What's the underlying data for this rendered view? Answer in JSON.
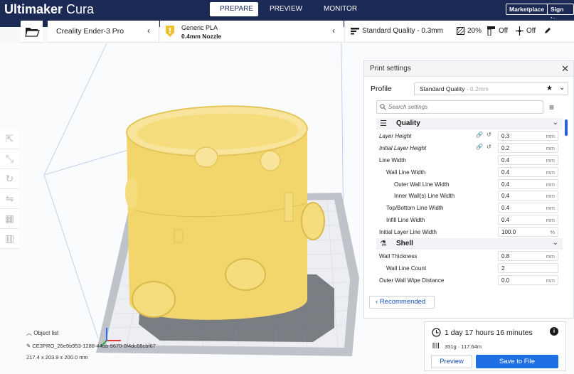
{
  "app": {
    "brand_bold": "Ultimaker",
    "brand_light": " Cura"
  },
  "stages": [
    "PREPARE",
    "PREVIEW",
    "MONITOR"
  ],
  "header_buttons": {
    "marketplace": "Marketplace",
    "signin": "Sign in"
  },
  "printer": {
    "name": "Creality Ender-3 Pro"
  },
  "material": {
    "name": "Generic PLA",
    "nozzle": "0.4mm Nozzle"
  },
  "quality_bar": {
    "profile": "Standard Quality - 0.3mm",
    "infill": "20%",
    "support": "Off",
    "adhesion": "Off"
  },
  "print_settings": {
    "title": "Print settings",
    "profile_label": "Profile",
    "profile_name": "Standard Quality",
    "profile_suffix": " - 0.2mm",
    "search_placeholder": "Search settings",
    "categories": [
      {
        "name": "Quality",
        "icon": "quality-icon"
      },
      {
        "name": "Shell",
        "icon": "shell-icon"
      }
    ],
    "quality_rows": [
      {
        "label": "Layer Height",
        "value": "0.3",
        "unit": "mm",
        "italic": true,
        "linked": true
      },
      {
        "label": "Initial Layer Height",
        "value": "0.2",
        "unit": "mm",
        "italic": true,
        "linked": true
      },
      {
        "label": "Line Width",
        "value": "0.4",
        "unit": "mm"
      },
      {
        "label": "Wall Line Width",
        "value": "0.4",
        "unit": "mm"
      },
      {
        "label": "Outer Wall Line Width",
        "value": "0.4",
        "unit": "mm"
      },
      {
        "label": "Inner Wall(s) Line Width",
        "value": "0.4",
        "unit": "mm"
      },
      {
        "label": "Top/Bottom Line Width",
        "value": "0.4",
        "unit": "mm"
      },
      {
        "label": "Infill Line Width",
        "value": "0.4",
        "unit": "mm"
      },
      {
        "label": "Initial Layer Line Width",
        "value": "100.0",
        "unit": "%"
      }
    ],
    "shell_rows": [
      {
        "label": "Wall Thickness",
        "value": "0.8",
        "unit": "mm"
      },
      {
        "label": "Wall Line Count",
        "value": "2",
        "unit": ""
      },
      {
        "label": "Outer Wall Wipe Distance",
        "value": "0.0",
        "unit": "mm"
      }
    ],
    "recommended_label": "Recommended"
  },
  "estimate": {
    "time": "1 day 17 hours 16 minutes",
    "material": "351g · 117.64m",
    "preview_label": "Preview",
    "save_label": "Save to File"
  },
  "object_list": {
    "label": "Object list",
    "object_name": "CE3PRO_26e9b953-1288-44ab-9670-0f4dc88cbf67",
    "dimensions": "217.4 x 203.9 x 200.0 mm"
  },
  "colors": {
    "header": "#1b2a55",
    "model": "#f7dc78",
    "accent": "#1f6fe5",
    "build_plate": "#c8ccd2"
  }
}
